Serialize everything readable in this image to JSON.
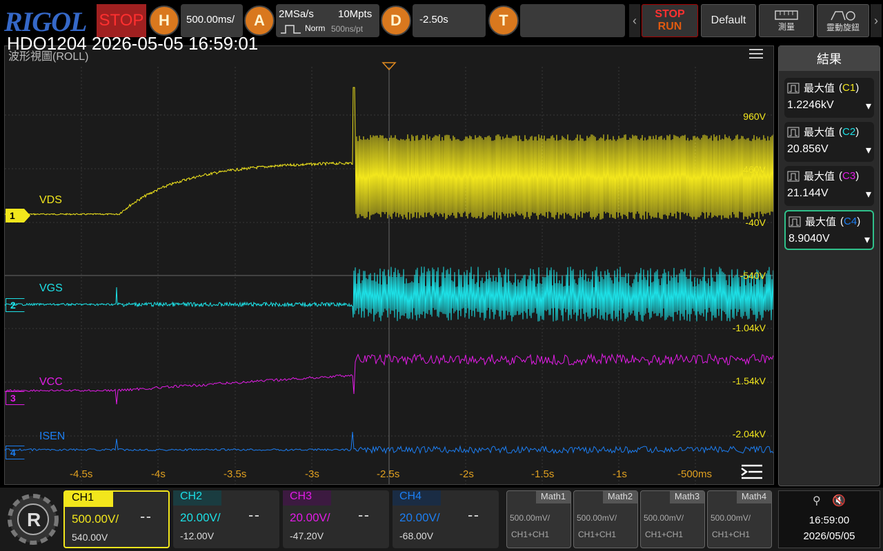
{
  "header": {
    "logo": "RIGOL",
    "run_state": "STOP",
    "horizontal_button": "H",
    "timebase": "500.00ms/",
    "acquire_button": "A",
    "sample_rate": "2MSa/s",
    "memory_depth": "10Mpts",
    "acq_mode": "Norm",
    "time_per_point": "500ns/pt",
    "delay_button": "D",
    "delay_value": "-2.50s",
    "trigger_button": "T",
    "run_stop_top": "STOP",
    "run_stop_bottom": "RUN",
    "default_label": "Default",
    "measure_label": "測量",
    "knob_label": "靈動旋鈕"
  },
  "screen": {
    "instrument_title": "HDO1204 2026-05-05 16:59:01",
    "view_label": "波形視圖(ROLL)"
  },
  "channels": [
    {
      "marker": "1",
      "name": "VDS",
      "color": "#f2e61c"
    },
    {
      "marker": "2",
      "name": "VGS",
      "color": "#1ce0e6"
    },
    {
      "marker": "3",
      "name": "VCC",
      "color": "#e21ce6"
    },
    {
      "marker": "4",
      "name": "ISEN",
      "color": "#1c7ef2"
    }
  ],
  "volt_labels": [
    "960V",
    "460V",
    "-40V",
    "-540V",
    "-1.04kV",
    "-1.54kV",
    "-2.04kV"
  ],
  "time_labels": [
    "-4.5s",
    "-4s",
    "-3.5s",
    "-3s",
    "-2.5s",
    "-2s",
    "-1.5s",
    "-1s",
    "-500ms"
  ],
  "results": {
    "title": "結果",
    "items": [
      {
        "label": "最大值",
        "src": "C1",
        "value": "1.2246kV",
        "color": "#f2e61c"
      },
      {
        "label": "最大值",
        "src": "C2",
        "value": "20.856V",
        "color": "#1ce0e6"
      },
      {
        "label": "最大值",
        "src": "C3",
        "value": "21.144V",
        "color": "#e21ce6"
      },
      {
        "label": "最大值",
        "src": "C4",
        "value": "8.9040V",
        "color": "#1c7ef2"
      }
    ]
  },
  "bottom": {
    "ch_boxes": [
      {
        "name": "CH1",
        "scale": "500.00V/",
        "offset": "540.00V",
        "color": "#f2e61c"
      },
      {
        "name": "CH2",
        "scale": "20.00V/",
        "offset": "-12.00V",
        "color": "#1ce0e6"
      },
      {
        "name": "CH3",
        "scale": "20.00V/",
        "offset": "-47.20V",
        "color": "#e21ce6"
      },
      {
        "name": "CH4",
        "scale": "20.00V/",
        "offset": "-68.00V",
        "color": "#1c7ef2"
      }
    ],
    "math_boxes": [
      {
        "name": "Math1",
        "scale": "500.00mV/",
        "src": "CH1+CH1"
      },
      {
        "name": "Math2",
        "scale": "500.00mV/",
        "src": "CH1+CH1"
      },
      {
        "name": "Math3",
        "scale": "500.00mV/",
        "src": "CH1+CH1"
      },
      {
        "name": "Math4",
        "scale": "500.00mV/",
        "src": "CH1+CH1"
      }
    ],
    "time": "16:59:00",
    "date": "2026/05/05"
  }
}
